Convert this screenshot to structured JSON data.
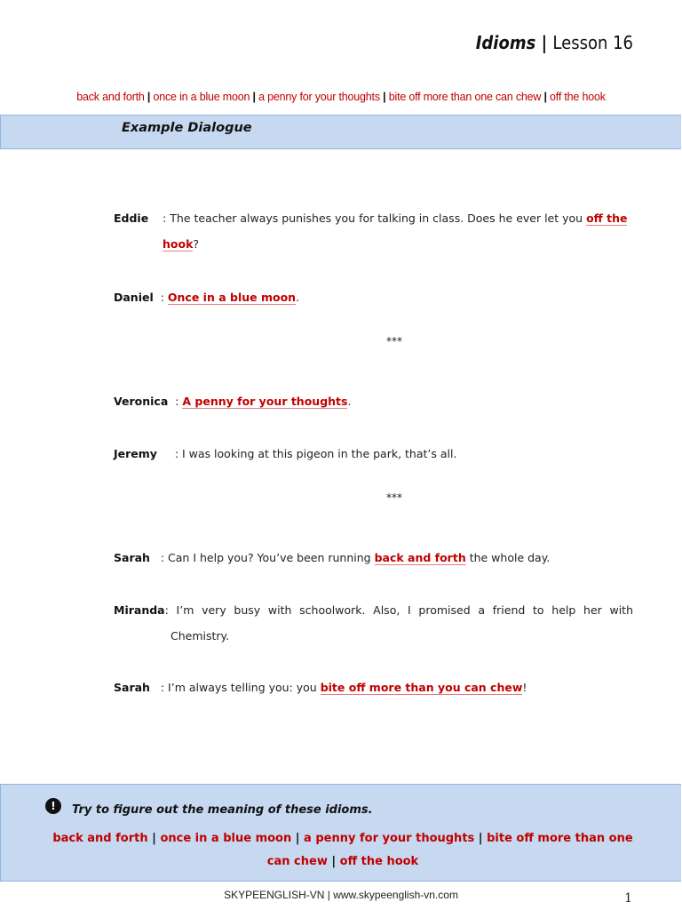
{
  "header": {
    "title_italic": "Idioms",
    "title_sep": " | ",
    "title_rest": "Lesson 16"
  },
  "idioms": [
    "back and forth",
    "once in a blue moon",
    "a penny for your thoughts",
    "bite off more than one can chew",
    "off the hook"
  ],
  "section_heading": "Example Dialogue",
  "separator": "***",
  "dialogue": [
    {
      "speaker": "Eddie",
      "sep": "    : ",
      "segments": [
        {
          "t": "The teacher always punishes you for talking in class. Does he ever let you "
        },
        {
          "t": "off the hook",
          "idiom": true
        },
        {
          "t": "?"
        }
      ]
    },
    {
      "speaker": "Daniel",
      "sep": "  : ",
      "segments": [
        {
          "t": "Once in a blue moon",
          "idiom": true
        },
        {
          "t": "."
        }
      ]
    },
    {
      "speaker": "Veronica",
      "sep": "  : ",
      "segments": [
        {
          "t": "A penny for your thoughts",
          "idiom": true
        },
        {
          "t": "."
        }
      ]
    },
    {
      "speaker": "Jeremy",
      "sep": "     : ",
      "segments": [
        {
          "t": "I was looking at this pigeon in the park, that’s all."
        }
      ]
    },
    {
      "speaker": "Sarah",
      "sep": "   : ",
      "segments": [
        {
          "t": "Can I help you? You’ve been running "
        },
        {
          "t": "back and forth",
          "idiom": true
        },
        {
          "t": " the whole day."
        }
      ]
    },
    {
      "speaker": "Miranda",
      "sep": ": ",
      "segments": [
        {
          "t": "I’m very busy with schoolwork. Also, I promised a friend to help her with Chemistry."
        }
      ]
    },
    {
      "speaker": "Sarah",
      "sep": "   : ",
      "segments": [
        {
          "t": "I’m always telling you: you "
        },
        {
          "t": "bite off more than you can chew",
          "idiom": true
        },
        {
          "t": "!"
        }
      ]
    }
  ],
  "exercise": {
    "prompt": "Try to figure out the meaning of these idioms.",
    "icon": "exclamation-icon"
  },
  "footer": {
    "text": "SKYPEENGLISH-VN | www.skypeenglish-vn.com",
    "page": "1"
  },
  "colors": {
    "accent": "#c00000",
    "band": "#c6d9f1"
  }
}
